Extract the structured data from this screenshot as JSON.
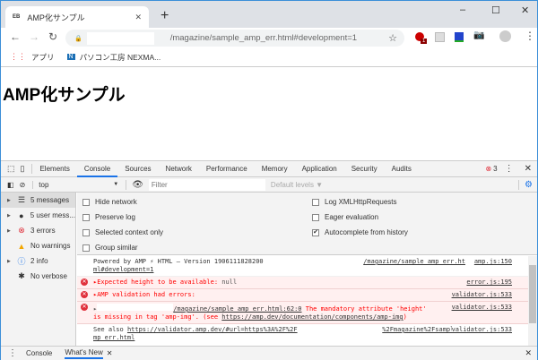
{
  "browser": {
    "tab_title": "AMP化サンプル",
    "favicon": "EB",
    "url": "/magazine/sample_amp_err.html#development=1",
    "ext_badge": "1",
    "bookmarks": [
      {
        "label": "アプリ"
      },
      {
        "label": "パソコン工房 NEXMA..."
      }
    ]
  },
  "page": {
    "heading": "AMP化サンプル"
  },
  "devtools": {
    "tabs": [
      "Elements",
      "Console",
      "Sources",
      "Network",
      "Performance",
      "Memory",
      "Application",
      "Security",
      "Audits"
    ],
    "error_count": "3",
    "context": "top",
    "filter_placeholder": "Filter",
    "levels": "Default levels ▼",
    "sidebar": [
      {
        "label": "5 messages",
        "icon": "list-icon"
      },
      {
        "label": "5 user mess...",
        "icon": "user-icon"
      },
      {
        "label": "3 errors",
        "icon": "error-icon"
      },
      {
        "label": "No warnings",
        "icon": "warning-icon"
      },
      {
        "label": "2 info",
        "icon": "info-icon"
      },
      {
        "label": "No verbose",
        "icon": "bug-icon"
      }
    ],
    "settings": [
      {
        "label": "Hide network",
        "checked": false
      },
      {
        "label": "Preserve log",
        "checked": false
      },
      {
        "label": "Selected context only",
        "checked": false
      },
      {
        "label": "Group similar",
        "checked": false
      },
      {
        "label": "Log XMLHttpRequests",
        "checked": false
      },
      {
        "label": "Eager evaluation",
        "checked": false
      },
      {
        "label": "Autocomplete from history",
        "checked": true
      }
    ],
    "messages": [
      {
        "type": "info",
        "text": "Powered by AMP ⚡ HTML – Version 1906111828200",
        "link": "/magazine/sample_amp_err.ht",
        "link2": "ml#development=1",
        "source": "amp.js:150"
      },
      {
        "type": "error",
        "text": "▸Expected height to be available:  ",
        "value": "null",
        "source": "error.js:195"
      },
      {
        "type": "error",
        "text": "▸AMP validation had errors:",
        "source": "validator.js:533"
      },
      {
        "type": "error",
        "link": "/magazine/sample_amp_err.html:62:0",
        "text": " The mandatory attribute 'height'",
        "text2": "is missing in tag 'amp-img'. (see ",
        "url": "https://amp.dev/documentation/components/amp-img",
        "text3": ")",
        "source": "validator.js:533"
      },
      {
        "type": "info",
        "text": "See also ",
        "url": "https://validator.amp.dev/#url=https%3A%2F%2F",
        "url_b": "%2Fmagazine%2Fsample_a",
        "url2": "mp_err.html",
        "source": "validator.js:533"
      }
    ],
    "drawer_tabs": [
      "Console",
      "What's New"
    ]
  }
}
